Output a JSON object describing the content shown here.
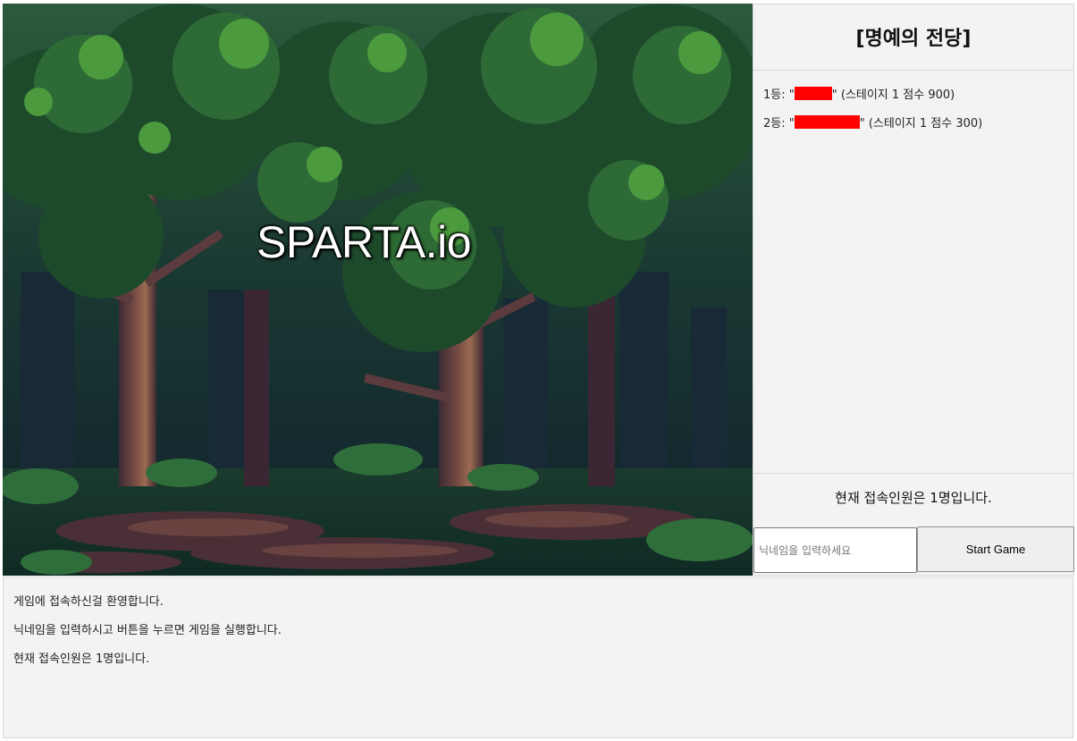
{
  "game": {
    "title": "SPARTA.io",
    "background": "pixel-forest"
  },
  "hall_of_fame": {
    "title": "[명예의 전당]",
    "entries": [
      {
        "rank_label": "1등: \"",
        "name_redacted": true,
        "suffix": "\" (스테이지 1 점수 900)"
      },
      {
        "rank_label": "2등: \"",
        "name_redacted": true,
        "suffix": "\" (스테이지 1 점수 300)"
      }
    ]
  },
  "online_status": "현재 접속인원은 1명입니다.",
  "nickname_input": {
    "value": "",
    "placeholder": "닉네임을 입력하세요"
  },
  "start_button": "Start Game",
  "log": [
    "게임에 접속하신걸 환영합니다.",
    "닉네임을 입력하시고 버튼을 누르면 게임을 실행합니다.",
    "현재 접속인원은 1명입니다."
  ],
  "colors": {
    "redaction": "#ff0000",
    "panel_bg": "#f3f3f3",
    "border": "#d8d8d8"
  }
}
